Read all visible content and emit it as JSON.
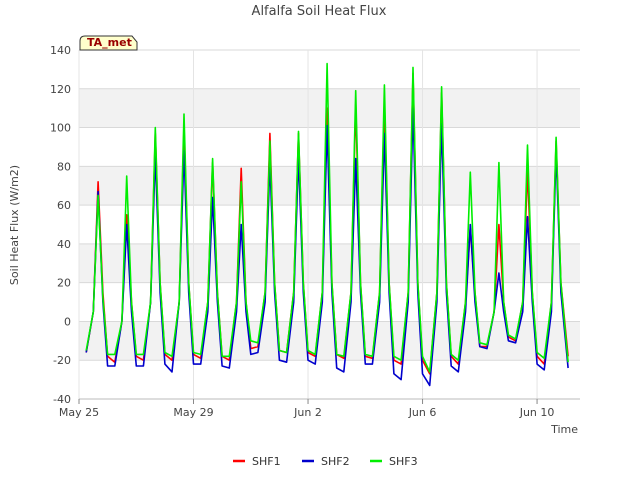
{
  "chart_data": {
    "type": "line",
    "title": "Alfalfa Soil Heat Flux",
    "xlabel": "Time",
    "ylabel": "Soil Heat Flux (W/m2)",
    "ylim": [
      -40,
      140
    ],
    "yticks": [
      -40,
      -20,
      0,
      20,
      40,
      60,
      80,
      100,
      120,
      140
    ],
    "xlim": [
      "2024-05-25",
      "2024-06-11T12:00"
    ],
    "xticks": [
      {
        "label": "May 25",
        "date": "2024-05-25"
      },
      {
        "label": "May 29",
        "date": "2024-05-29"
      },
      {
        "label": "Jun 2",
        "date": "2024-06-02"
      },
      {
        "label": "Jun 6",
        "date": "2024-06-06"
      },
      {
        "label": "Jun 10",
        "date": "2024-06-10"
      }
    ],
    "grid": true,
    "legend_position": "bottom",
    "annotation": "TA_met",
    "series": [
      {
        "name": "SHF1",
        "color": "#ff0000",
        "points": [
          [
            "2024-05-25T06:00",
            -16
          ],
          [
            "2024-05-25T12:00",
            5
          ],
          [
            "2024-05-25T16:00",
            72
          ],
          [
            "2024-05-25T20:00",
            15
          ],
          [
            "2024-05-26T00:00",
            -18
          ],
          [
            "2024-05-26T06:00",
            -21
          ],
          [
            "2024-05-26T12:00",
            0
          ],
          [
            "2024-05-26T16:00",
            55
          ],
          [
            "2024-05-26T20:00",
            10
          ],
          [
            "2024-05-27T00:00",
            -18
          ],
          [
            "2024-05-27T06:00",
            -20
          ],
          [
            "2024-05-27T12:00",
            10
          ],
          [
            "2024-05-27T16:00",
            97
          ],
          [
            "2024-05-27T20:00",
            20
          ],
          [
            "2024-05-28T00:00",
            -17
          ],
          [
            "2024-05-28T06:00",
            -20
          ],
          [
            "2024-05-28T12:00",
            10
          ],
          [
            "2024-05-28T16:00",
            100
          ],
          [
            "2024-05-28T20:00",
            20
          ],
          [
            "2024-05-29T00:00",
            -17
          ],
          [
            "2024-05-29T06:00",
            -19
          ],
          [
            "2024-05-29T12:00",
            10
          ],
          [
            "2024-05-29T16:00",
            82
          ],
          [
            "2024-05-29T20:00",
            15
          ],
          [
            "2024-05-30T00:00",
            -18
          ],
          [
            "2024-05-30T06:00",
            -20
          ],
          [
            "2024-05-30T12:00",
            10
          ],
          [
            "2024-05-30T16:00",
            79
          ],
          [
            "2024-05-30T20:00",
            10
          ],
          [
            "2024-05-31T00:00",
            -14
          ],
          [
            "2024-05-31T06:00",
            -13
          ],
          [
            "2024-05-31T12:00",
            15
          ],
          [
            "2024-05-31T16:00",
            97
          ],
          [
            "2024-05-31T20:00",
            20
          ],
          [
            "2024-06-01T00:00",
            -15
          ],
          [
            "2024-06-01T06:00",
            -16
          ],
          [
            "2024-06-01T12:00",
            15
          ],
          [
            "2024-06-01T16:00",
            97
          ],
          [
            "2024-06-01T20:00",
            20
          ],
          [
            "2024-06-02T00:00",
            -16
          ],
          [
            "2024-06-02T06:00",
            -18
          ],
          [
            "2024-06-02T12:00",
            15
          ],
          [
            "2024-06-02T16:00",
            110
          ],
          [
            "2024-06-02T20:00",
            20
          ],
          [
            "2024-06-03T00:00",
            -17
          ],
          [
            "2024-06-03T06:00",
            -19
          ],
          [
            "2024-06-03T12:00",
            15
          ],
          [
            "2024-06-03T16:00",
            112
          ],
          [
            "2024-06-03T20:00",
            20
          ],
          [
            "2024-06-04T00:00",
            -18
          ],
          [
            "2024-06-04T06:00",
            -19
          ],
          [
            "2024-06-04T12:00",
            15
          ],
          [
            "2024-06-04T16:00",
            113
          ],
          [
            "2024-06-04T20:00",
            20
          ],
          [
            "2024-06-05T00:00",
            -20
          ],
          [
            "2024-06-05T06:00",
            -22
          ],
          [
            "2024-06-05T12:00",
            15
          ],
          [
            "2024-06-05T16:00",
            128
          ],
          [
            "2024-06-05T20:00",
            20
          ],
          [
            "2024-06-06T00:00",
            -20
          ],
          [
            "2024-06-06T06:00",
            -27
          ],
          [
            "2024-06-06T12:00",
            15
          ],
          [
            "2024-06-06T16:00",
            118
          ],
          [
            "2024-06-06T20:00",
            20
          ],
          [
            "2024-06-07T00:00",
            -18
          ],
          [
            "2024-06-07T06:00",
            -22
          ],
          [
            "2024-06-07T12:00",
            10
          ],
          [
            "2024-06-07T16:00",
            48
          ],
          [
            "2024-06-07T20:00",
            15
          ],
          [
            "2024-06-08T00:00",
            -13
          ],
          [
            "2024-06-08T06:00",
            -13
          ],
          [
            "2024-06-08T12:00",
            5
          ],
          [
            "2024-06-08T16:00",
            50
          ],
          [
            "2024-06-08T20:00",
            10
          ],
          [
            "2024-06-09T00:00",
            -8
          ],
          [
            "2024-06-09T06:00",
            -10
          ],
          [
            "2024-06-09T12:00",
            10
          ],
          [
            "2024-06-09T16:00",
            78
          ],
          [
            "2024-06-09T20:00",
            15
          ],
          [
            "2024-06-10T00:00",
            -18
          ],
          [
            "2024-06-10T06:00",
            -22
          ],
          [
            "2024-06-10T12:00",
            10
          ],
          [
            "2024-06-10T16:00",
            93
          ],
          [
            "2024-06-10T20:00",
            20
          ],
          [
            "2024-06-11T02:00",
            -18
          ]
        ]
      },
      {
        "name": "SHF2",
        "color": "#0000cc",
        "points": [
          [
            "2024-05-25T06:00",
            -16
          ],
          [
            "2024-05-25T12:00",
            5
          ],
          [
            "2024-05-25T16:00",
            67
          ],
          [
            "2024-05-25T20:00",
            10
          ],
          [
            "2024-05-26T00:00",
            -23
          ],
          [
            "2024-05-26T06:00",
            -23
          ],
          [
            "2024-05-26T12:00",
            0
          ],
          [
            "2024-05-26T16:00",
            50
          ],
          [
            "2024-05-26T20:00",
            5
          ],
          [
            "2024-05-27T00:00",
            -23
          ],
          [
            "2024-05-27T06:00",
            -23
          ],
          [
            "2024-05-27T12:00",
            10
          ],
          [
            "2024-05-27T16:00",
            86
          ],
          [
            "2024-05-27T20:00",
            15
          ],
          [
            "2024-05-28T00:00",
            -22
          ],
          [
            "2024-05-28T06:00",
            -26
          ],
          [
            "2024-05-28T12:00",
            10
          ],
          [
            "2024-05-28T16:00",
            88
          ],
          [
            "2024-05-28T20:00",
            15
          ],
          [
            "2024-05-29T00:00",
            -22
          ],
          [
            "2024-05-29T06:00",
            -22
          ],
          [
            "2024-05-29T12:00",
            5
          ],
          [
            "2024-05-29T16:00",
            64
          ],
          [
            "2024-05-29T20:00",
            10
          ],
          [
            "2024-05-30T00:00",
            -23
          ],
          [
            "2024-05-30T06:00",
            -24
          ],
          [
            "2024-05-30T12:00",
            5
          ],
          [
            "2024-05-30T16:00",
            50
          ],
          [
            "2024-05-30T20:00",
            5
          ],
          [
            "2024-05-31T00:00",
            -17
          ],
          [
            "2024-05-31T06:00",
            -16
          ],
          [
            "2024-05-31T12:00",
            10
          ],
          [
            "2024-05-31T16:00",
            82
          ],
          [
            "2024-05-31T20:00",
            15
          ],
          [
            "2024-06-01T00:00",
            -20
          ],
          [
            "2024-06-01T06:00",
            -21
          ],
          [
            "2024-06-01T12:00",
            10
          ],
          [
            "2024-06-01T16:00",
            85
          ],
          [
            "2024-06-01T20:00",
            15
          ],
          [
            "2024-06-02T00:00",
            -20
          ],
          [
            "2024-06-02T06:00",
            -22
          ],
          [
            "2024-06-02T12:00",
            10
          ],
          [
            "2024-06-02T16:00",
            101
          ],
          [
            "2024-06-02T20:00",
            15
          ],
          [
            "2024-06-03T00:00",
            -24
          ],
          [
            "2024-06-03T06:00",
            -26
          ],
          [
            "2024-06-03T12:00",
            10
          ],
          [
            "2024-06-03T16:00",
            84
          ],
          [
            "2024-06-03T20:00",
            15
          ],
          [
            "2024-06-04T00:00",
            -22
          ],
          [
            "2024-06-04T06:00",
            -22
          ],
          [
            "2024-06-04T12:00",
            10
          ],
          [
            "2024-06-04T16:00",
            97
          ],
          [
            "2024-06-04T20:00",
            15
          ],
          [
            "2024-06-05T00:00",
            -27
          ],
          [
            "2024-06-05T06:00",
            -30
          ],
          [
            "2024-06-05T12:00",
            10
          ],
          [
            "2024-06-05T16:00",
            110
          ],
          [
            "2024-06-05T20:00",
            15
          ],
          [
            "2024-06-06T00:00",
            -27
          ],
          [
            "2024-06-06T06:00",
            -33
          ],
          [
            "2024-06-06T12:00",
            10
          ],
          [
            "2024-06-06T16:00",
            102
          ],
          [
            "2024-06-06T20:00",
            15
          ],
          [
            "2024-06-07T00:00",
            -23
          ],
          [
            "2024-06-07T06:00",
            -26
          ],
          [
            "2024-06-07T12:00",
            5
          ],
          [
            "2024-06-07T16:00",
            50
          ],
          [
            "2024-06-07T20:00",
            10
          ],
          [
            "2024-06-08T00:00",
            -13
          ],
          [
            "2024-06-08T06:00",
            -14
          ],
          [
            "2024-06-08T12:00",
            5
          ],
          [
            "2024-06-08T16:00",
            25
          ],
          [
            "2024-06-08T20:00",
            5
          ],
          [
            "2024-06-09T00:00",
            -10
          ],
          [
            "2024-06-09T06:00",
            -11
          ],
          [
            "2024-06-09T12:00",
            5
          ],
          [
            "2024-06-09T16:00",
            54
          ],
          [
            "2024-06-09T20:00",
            10
          ],
          [
            "2024-06-10T00:00",
            -22
          ],
          [
            "2024-06-10T06:00",
            -25
          ],
          [
            "2024-06-10T12:00",
            5
          ],
          [
            "2024-06-10T16:00",
            88
          ],
          [
            "2024-06-10T20:00",
            15
          ],
          [
            "2024-06-11T02:00",
            -24
          ]
        ]
      },
      {
        "name": "SHF3",
        "color": "#00ee00",
        "points": [
          [
            "2024-05-25T06:00",
            -15
          ],
          [
            "2024-05-25T12:00",
            5
          ],
          [
            "2024-05-25T16:00",
            65
          ],
          [
            "2024-05-25T20:00",
            12
          ],
          [
            "2024-05-26T00:00",
            -17
          ],
          [
            "2024-05-26T06:00",
            -17
          ],
          [
            "2024-05-26T12:00",
            0
          ],
          [
            "2024-05-26T16:00",
            75
          ],
          [
            "2024-05-26T20:00",
            10
          ],
          [
            "2024-05-27T00:00",
            -17
          ],
          [
            "2024-05-27T06:00",
            -17
          ],
          [
            "2024-05-27T12:00",
            10
          ],
          [
            "2024-05-27T16:00",
            100
          ],
          [
            "2024-05-27T20:00",
            20
          ],
          [
            "2024-05-28T00:00",
            -16
          ],
          [
            "2024-05-28T06:00",
            -18
          ],
          [
            "2024-05-28T12:00",
            10
          ],
          [
            "2024-05-28T16:00",
            107
          ],
          [
            "2024-05-28T20:00",
            20
          ],
          [
            "2024-05-29T00:00",
            -16
          ],
          [
            "2024-05-29T06:00",
            -17
          ],
          [
            "2024-05-29T12:00",
            10
          ],
          [
            "2024-05-29T16:00",
            84
          ],
          [
            "2024-05-29T20:00",
            15
          ],
          [
            "2024-05-30T00:00",
            -18
          ],
          [
            "2024-05-30T06:00",
            -18
          ],
          [
            "2024-05-30T12:00",
            10
          ],
          [
            "2024-05-30T16:00",
            72
          ],
          [
            "2024-05-30T20:00",
            10
          ],
          [
            "2024-05-31T00:00",
            -10
          ],
          [
            "2024-05-31T06:00",
            -11
          ],
          [
            "2024-05-31T12:00",
            15
          ],
          [
            "2024-05-31T16:00",
            93
          ],
          [
            "2024-05-31T20:00",
            20
          ],
          [
            "2024-06-01T00:00",
            -15
          ],
          [
            "2024-06-01T06:00",
            -16
          ],
          [
            "2024-06-01T12:00",
            15
          ],
          [
            "2024-06-01T16:00",
            98
          ],
          [
            "2024-06-01T20:00",
            20
          ],
          [
            "2024-06-02T00:00",
            -15
          ],
          [
            "2024-06-02T06:00",
            -17
          ],
          [
            "2024-06-02T12:00",
            15
          ],
          [
            "2024-06-02T16:00",
            133
          ],
          [
            "2024-06-02T20:00",
            20
          ],
          [
            "2024-06-03T00:00",
            -17
          ],
          [
            "2024-06-03T06:00",
            -18
          ],
          [
            "2024-06-03T12:00",
            15
          ],
          [
            "2024-06-03T16:00",
            119
          ],
          [
            "2024-06-03T20:00",
            20
          ],
          [
            "2024-06-04T00:00",
            -17
          ],
          [
            "2024-06-04T06:00",
            -18
          ],
          [
            "2024-06-04T12:00",
            15
          ],
          [
            "2024-06-04T16:00",
            122
          ],
          [
            "2024-06-04T20:00",
            20
          ],
          [
            "2024-06-05T00:00",
            -18
          ],
          [
            "2024-06-05T06:00",
            -20
          ],
          [
            "2024-06-05T12:00",
            15
          ],
          [
            "2024-06-05T16:00",
            131
          ],
          [
            "2024-06-05T20:00",
            20
          ],
          [
            "2024-06-06T00:00",
            -18
          ],
          [
            "2024-06-06T06:00",
            -26
          ],
          [
            "2024-06-06T12:00",
            15
          ],
          [
            "2024-06-06T16:00",
            121
          ],
          [
            "2024-06-06T20:00",
            20
          ],
          [
            "2024-06-07T00:00",
            -17
          ],
          [
            "2024-06-07T06:00",
            -20
          ],
          [
            "2024-06-07T12:00",
            10
          ],
          [
            "2024-06-07T16:00",
            77
          ],
          [
            "2024-06-07T20:00",
            15
          ],
          [
            "2024-06-08T00:00",
            -11
          ],
          [
            "2024-06-08T06:00",
            -12
          ],
          [
            "2024-06-08T12:00",
            5
          ],
          [
            "2024-06-08T16:00",
            82
          ],
          [
            "2024-06-08T20:00",
            10
          ],
          [
            "2024-06-09T00:00",
            -7
          ],
          [
            "2024-06-09T06:00",
            -9
          ],
          [
            "2024-06-09T12:00",
            10
          ],
          [
            "2024-06-09T16:00",
            91
          ],
          [
            "2024-06-09T20:00",
            15
          ],
          [
            "2024-06-10T00:00",
            -16
          ],
          [
            "2024-06-10T06:00",
            -19
          ],
          [
            "2024-06-10T12:00",
            10
          ],
          [
            "2024-06-10T16:00",
            95
          ],
          [
            "2024-06-10T20:00",
            20
          ],
          [
            "2024-06-11T02:00",
            -21
          ]
        ]
      }
    ]
  }
}
